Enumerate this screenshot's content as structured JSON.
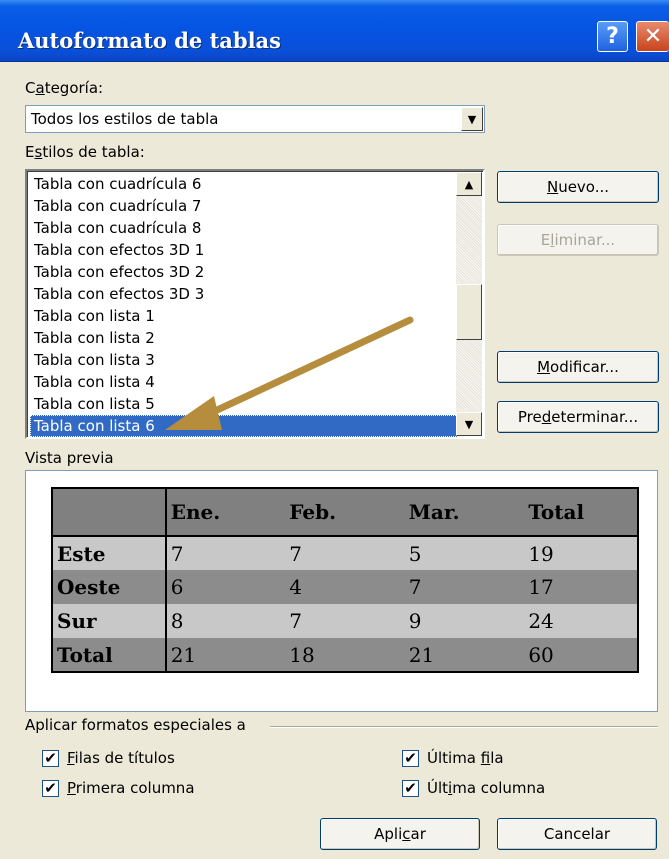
{
  "window": {
    "title": "Autoformato de tablas",
    "help_glyph": "?",
    "close_glyph": "✕"
  },
  "categoria": {
    "label_prefix": "C",
    "label_underlined": "a",
    "label_rest": "tegoría:",
    "value": "Todos los estilos de tabla"
  },
  "estilos": {
    "label_prefix": "E",
    "label_underlined": "s",
    "label_rest": "tilos de tabla:",
    "items": [
      "Tabla con cuadrícula 6",
      "Tabla con cuadrícula 7",
      "Tabla con cuadrícula 8",
      "Tabla con efectos 3D 1",
      "Tabla con efectos 3D 2",
      "Tabla con efectos 3D 3",
      "Tabla con lista 1",
      "Tabla con lista 2",
      "Tabla con lista 3",
      "Tabla con lista 4",
      "Tabla con lista 5",
      "Tabla con lista 6"
    ],
    "selected": "Tabla con lista 6"
  },
  "buttons": {
    "nuevo": {
      "underlined": "N",
      "rest": "uevo..."
    },
    "eliminar": {
      "prefix": "E",
      "underlined": "l",
      "rest": "iminar..."
    },
    "modificar": {
      "underlined": "M",
      "rest": "odificar..."
    },
    "predeterminar": {
      "prefix": "Pre",
      "underlined": "d",
      "rest": "eterminar..."
    },
    "aplicar": {
      "prefix": "Apli",
      "underlined": "c",
      "rest": "ar"
    },
    "cancelar": "Cancelar"
  },
  "vista_previa": {
    "label": "Vista previa",
    "header": [
      "",
      "Ene.",
      "Feb.",
      "Mar.",
      "Total"
    ],
    "rows": [
      [
        "Este",
        "7",
        "7",
        "5",
        "19"
      ],
      [
        "Oeste",
        "6",
        "4",
        "7",
        "17"
      ],
      [
        "Sur",
        "8",
        "7",
        "9",
        "24"
      ],
      [
        "Total",
        "21",
        "18",
        "21",
        "60"
      ]
    ]
  },
  "formatos": {
    "label": "Aplicar formatos especiales a",
    "filas_titulos": {
      "prefix": "",
      "underlined": "F",
      "rest": "ilas de títulos",
      "checked": true
    },
    "primera_columna": {
      "prefix": "",
      "underlined": "P",
      "rest": "rimera columna",
      "checked": true
    },
    "ultima_fila": {
      "prefix": "Última ",
      "underlined": "f",
      "rest": "ila",
      "checked": true
    },
    "ultima_columna": {
      "prefix": "Últ",
      "underlined": "i",
      "rest": "ma columna",
      "checked": true
    },
    "check_glyph": "✔"
  },
  "colors": {
    "title_gradient_mid": "#0554e3",
    "selection": "#316ac5",
    "dialog_bg": "#ece9d8",
    "arrow": "#b58d3d"
  }
}
